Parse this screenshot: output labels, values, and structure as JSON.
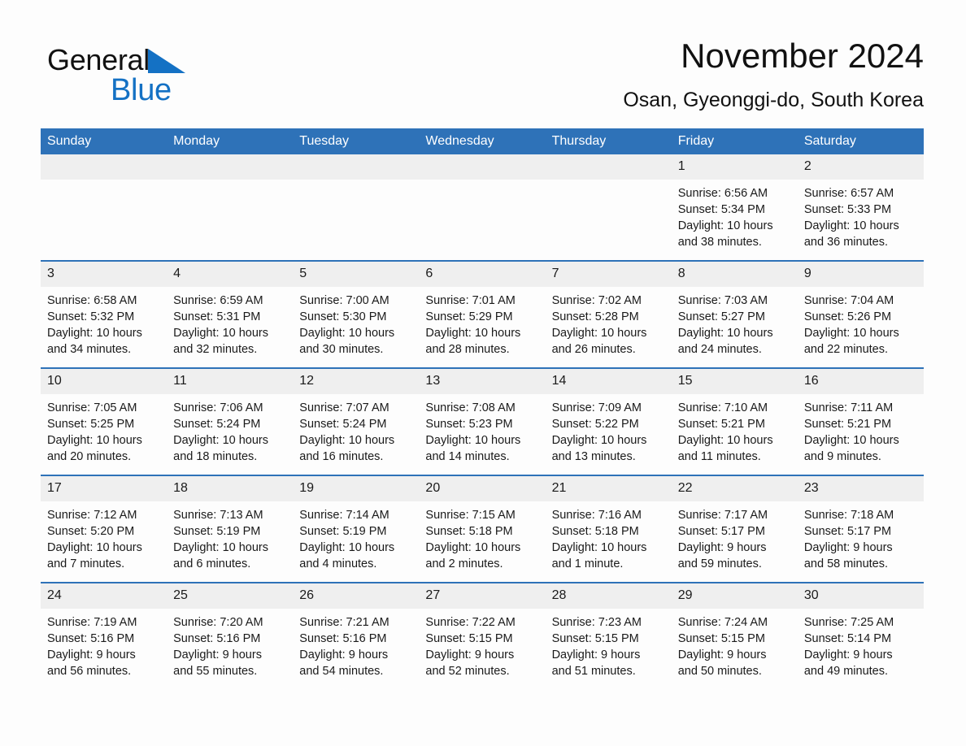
{
  "logo": {
    "word_dark": "General",
    "word_light": "Blue",
    "mark": "triangle-icon",
    "accent_color": "#1471c4"
  },
  "header": {
    "title": "November 2024",
    "subtitle": "Osan, Gyeonggi-do, South Korea"
  },
  "theme": {
    "header_blue": "#2e72b8",
    "day_band_gray": "#efefef",
    "page_background": "#fdfdfd",
    "text": "#1a1a1a"
  },
  "calendar": {
    "weekday_headers": [
      "Sunday",
      "Monday",
      "Tuesday",
      "Wednesday",
      "Thursday",
      "Friday",
      "Saturday"
    ],
    "weeks": [
      [
        {
          "day": "",
          "blank": true,
          "lines": [
            "",
            "",
            "",
            ""
          ]
        },
        {
          "day": "",
          "blank": true,
          "lines": [
            "",
            "",
            "",
            ""
          ]
        },
        {
          "day": "",
          "blank": true,
          "lines": [
            "",
            "",
            "",
            ""
          ]
        },
        {
          "day": "",
          "blank": true,
          "lines": [
            "",
            "",
            "",
            ""
          ]
        },
        {
          "day": "",
          "blank": true,
          "lines": [
            "",
            "",
            "",
            ""
          ]
        },
        {
          "day": "1",
          "blank": false,
          "lines": [
            "Sunrise: 6:56 AM",
            "Sunset: 5:34 PM",
            "Daylight: 10 hours",
            "and 38 minutes."
          ]
        },
        {
          "day": "2",
          "blank": false,
          "lines": [
            "Sunrise: 6:57 AM",
            "Sunset: 5:33 PM",
            "Daylight: 10 hours",
            "and 36 minutes."
          ]
        }
      ],
      [
        {
          "day": "3",
          "blank": false,
          "lines": [
            "Sunrise: 6:58 AM",
            "Sunset: 5:32 PM",
            "Daylight: 10 hours",
            "and 34 minutes."
          ]
        },
        {
          "day": "4",
          "blank": false,
          "lines": [
            "Sunrise: 6:59 AM",
            "Sunset: 5:31 PM",
            "Daylight: 10 hours",
            "and 32 minutes."
          ]
        },
        {
          "day": "5",
          "blank": false,
          "lines": [
            "Sunrise: 7:00 AM",
            "Sunset: 5:30 PM",
            "Daylight: 10 hours",
            "and 30 minutes."
          ]
        },
        {
          "day": "6",
          "blank": false,
          "lines": [
            "Sunrise: 7:01 AM",
            "Sunset: 5:29 PM",
            "Daylight: 10 hours",
            "and 28 minutes."
          ]
        },
        {
          "day": "7",
          "blank": false,
          "lines": [
            "Sunrise: 7:02 AM",
            "Sunset: 5:28 PM",
            "Daylight: 10 hours",
            "and 26 minutes."
          ]
        },
        {
          "day": "8",
          "blank": false,
          "lines": [
            "Sunrise: 7:03 AM",
            "Sunset: 5:27 PM",
            "Daylight: 10 hours",
            "and 24 minutes."
          ]
        },
        {
          "day": "9",
          "blank": false,
          "lines": [
            "Sunrise: 7:04 AM",
            "Sunset: 5:26 PM",
            "Daylight: 10 hours",
            "and 22 minutes."
          ]
        }
      ],
      [
        {
          "day": "10",
          "blank": false,
          "lines": [
            "Sunrise: 7:05 AM",
            "Sunset: 5:25 PM",
            "Daylight: 10 hours",
            "and 20 minutes."
          ]
        },
        {
          "day": "11",
          "blank": false,
          "lines": [
            "Sunrise: 7:06 AM",
            "Sunset: 5:24 PM",
            "Daylight: 10 hours",
            "and 18 minutes."
          ]
        },
        {
          "day": "12",
          "blank": false,
          "lines": [
            "Sunrise: 7:07 AM",
            "Sunset: 5:24 PM",
            "Daylight: 10 hours",
            "and 16 minutes."
          ]
        },
        {
          "day": "13",
          "blank": false,
          "lines": [
            "Sunrise: 7:08 AM",
            "Sunset: 5:23 PM",
            "Daylight: 10 hours",
            "and 14 minutes."
          ]
        },
        {
          "day": "14",
          "blank": false,
          "lines": [
            "Sunrise: 7:09 AM",
            "Sunset: 5:22 PM",
            "Daylight: 10 hours",
            "and 13 minutes."
          ]
        },
        {
          "day": "15",
          "blank": false,
          "lines": [
            "Sunrise: 7:10 AM",
            "Sunset: 5:21 PM",
            "Daylight: 10 hours",
            "and 11 minutes."
          ]
        },
        {
          "day": "16",
          "blank": false,
          "lines": [
            "Sunrise: 7:11 AM",
            "Sunset: 5:21 PM",
            "Daylight: 10 hours",
            "and 9 minutes."
          ]
        }
      ],
      [
        {
          "day": "17",
          "blank": false,
          "lines": [
            "Sunrise: 7:12 AM",
            "Sunset: 5:20 PM",
            "Daylight: 10 hours",
            "and 7 minutes."
          ]
        },
        {
          "day": "18",
          "blank": false,
          "lines": [
            "Sunrise: 7:13 AM",
            "Sunset: 5:19 PM",
            "Daylight: 10 hours",
            "and 6 minutes."
          ]
        },
        {
          "day": "19",
          "blank": false,
          "lines": [
            "Sunrise: 7:14 AM",
            "Sunset: 5:19 PM",
            "Daylight: 10 hours",
            "and 4 minutes."
          ]
        },
        {
          "day": "20",
          "blank": false,
          "lines": [
            "Sunrise: 7:15 AM",
            "Sunset: 5:18 PM",
            "Daylight: 10 hours",
            "and 2 minutes."
          ]
        },
        {
          "day": "21",
          "blank": false,
          "lines": [
            "Sunrise: 7:16 AM",
            "Sunset: 5:18 PM",
            "Daylight: 10 hours",
            "and 1 minute."
          ]
        },
        {
          "day": "22",
          "blank": false,
          "lines": [
            "Sunrise: 7:17 AM",
            "Sunset: 5:17 PM",
            "Daylight: 9 hours",
            "and 59 minutes."
          ]
        },
        {
          "day": "23",
          "blank": false,
          "lines": [
            "Sunrise: 7:18 AM",
            "Sunset: 5:17 PM",
            "Daylight: 9 hours",
            "and 58 minutes."
          ]
        }
      ],
      [
        {
          "day": "24",
          "blank": false,
          "lines": [
            "Sunrise: 7:19 AM",
            "Sunset: 5:16 PM",
            "Daylight: 9 hours",
            "and 56 minutes."
          ]
        },
        {
          "day": "25",
          "blank": false,
          "lines": [
            "Sunrise: 7:20 AM",
            "Sunset: 5:16 PM",
            "Daylight: 9 hours",
            "and 55 minutes."
          ]
        },
        {
          "day": "26",
          "blank": false,
          "lines": [
            "Sunrise: 7:21 AM",
            "Sunset: 5:16 PM",
            "Daylight: 9 hours",
            "and 54 minutes."
          ]
        },
        {
          "day": "27",
          "blank": false,
          "lines": [
            "Sunrise: 7:22 AM",
            "Sunset: 5:15 PM",
            "Daylight: 9 hours",
            "and 52 minutes."
          ]
        },
        {
          "day": "28",
          "blank": false,
          "lines": [
            "Sunrise: 7:23 AM",
            "Sunset: 5:15 PM",
            "Daylight: 9 hours",
            "and 51 minutes."
          ]
        },
        {
          "day": "29",
          "blank": false,
          "lines": [
            "Sunrise: 7:24 AM",
            "Sunset: 5:15 PM",
            "Daylight: 9 hours",
            "and 50 minutes."
          ]
        },
        {
          "day": "30",
          "blank": false,
          "lines": [
            "Sunrise: 7:25 AM",
            "Sunset: 5:14 PM",
            "Daylight: 9 hours",
            "and 49 minutes."
          ]
        }
      ]
    ]
  }
}
